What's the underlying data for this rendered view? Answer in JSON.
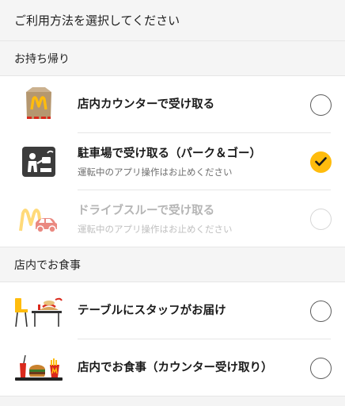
{
  "header": {
    "title": "ご利用方法を選択してください"
  },
  "sections": [
    {
      "title": "お持ち帰り",
      "items": [
        {
          "title": "店内カウンターで受け取る",
          "subtitle": "",
          "icon": "takeout-bag-icon",
          "state": "unchecked"
        },
        {
          "title": "駐車場で受け取る（パーク＆ゴー）",
          "subtitle": "運転中のアプリ操作はお止めください",
          "icon": "park-and-go-icon",
          "state": "checked"
        },
        {
          "title": "ドライブスルーで受け取る",
          "subtitle": "運転中のアプリ操作はお止めください",
          "icon": "drive-thru-icon",
          "state": "disabled"
        }
      ]
    },
    {
      "title": "店内でお食事",
      "items": [
        {
          "title": "テーブルにスタッフがお届け",
          "subtitle": "",
          "icon": "table-delivery-icon",
          "state": "unchecked"
        },
        {
          "title": "店内でお食事（カウンター受け取り）",
          "subtitle": "",
          "icon": "tray-meal-icon",
          "state": "unchecked"
        }
      ]
    }
  ],
  "colors": {
    "accent": "#ffbc0d",
    "brand_red": "#da291c",
    "check": "#1a1a1a"
  }
}
